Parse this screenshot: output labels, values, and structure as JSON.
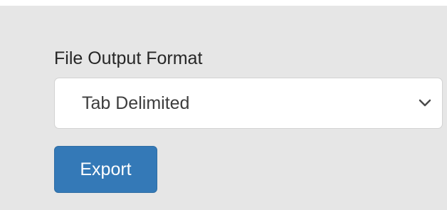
{
  "form": {
    "output_format_label": "File Output Format",
    "output_format_selected": "Tab Delimited",
    "output_format_icon": "chevron-down-icon",
    "export_label": "Export"
  },
  "colors": {
    "panel_background": "#e6e6e6",
    "export_button": "#3479b7",
    "export_text": "#ffffff"
  }
}
